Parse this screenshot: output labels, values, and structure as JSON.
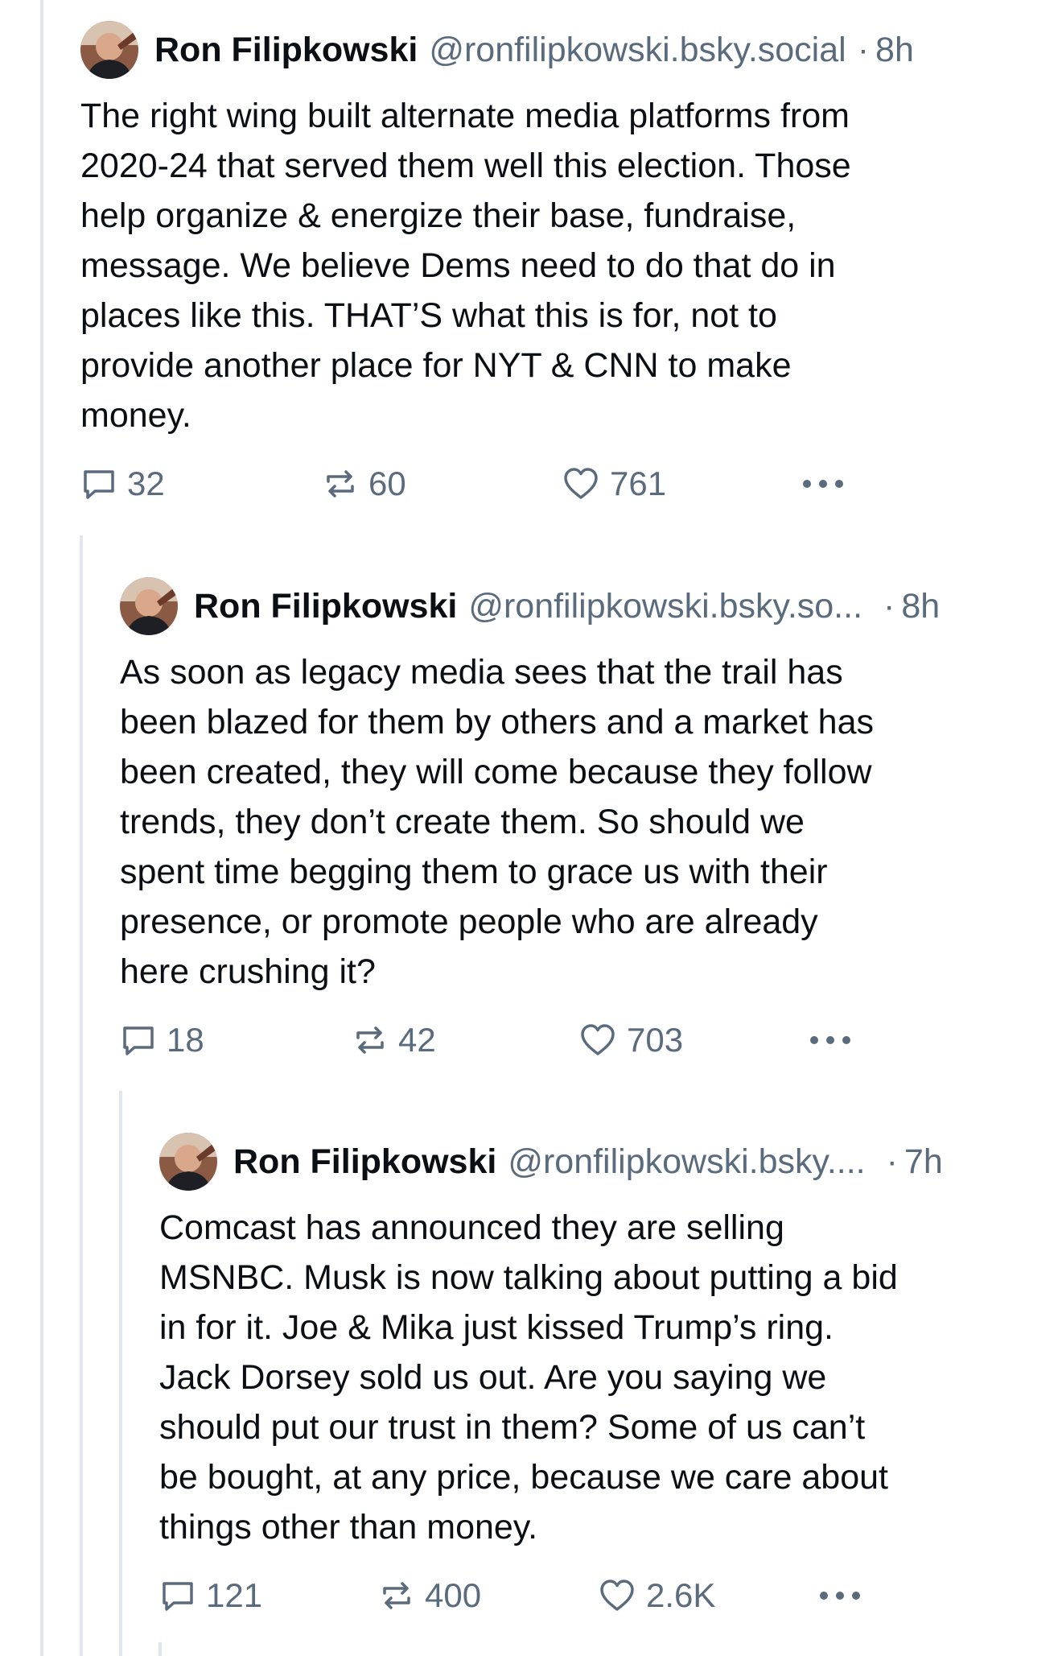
{
  "posts": [
    {
      "author": "Ron Filipkowski",
      "handle": "@ronfilipkowski.bsky.social",
      "separator": "·",
      "time": "8h",
      "text": "The right wing built alternate media platforms from\n2020-24 that served them well this election. Those\nhelp organize & energize their base, fundraise,\nmessage. We believe Dems need to do that do in\nplaces like this. THAT’S what this is for, not to\nprovide another place for NYT & CNN to make\nmoney.",
      "replies": "32",
      "reposts": "60",
      "likes": "761"
    },
    {
      "author": "Ron Filipkowski",
      "handle": "@ronfilipkowski.bsky.so...",
      "separator": "·",
      "time": "8h",
      "text": "As soon as legacy media sees that the trail has\nbeen blazed for them by others and a market has\nbeen created, they will come because they follow\ntrends, they don’t create them. So should we\nspent time begging them to grace us with their\npresence, or promote people who are already\nhere crushing it?",
      "replies": "18",
      "reposts": "42",
      "likes": "703"
    },
    {
      "author": "Ron Filipkowski",
      "handle": "@ronfilipkowski.bsky....",
      "separator": "·",
      "time": "7h",
      "text": "Comcast has announced they are selling\nMSNBC. Musk is now talking about putting a bid\nin for it. Joe & Mika just kissed Trump’s ring.\nJack Dorsey sold us out. Are you saying we\nshould put our trust in them? Some of us can’t\nbe bought, at any price, because we care about\nthings other than money.",
      "replies": "121",
      "reposts": "400",
      "likes": "2.6K"
    }
  ],
  "icons": {
    "reply": "speech-bubble-icon",
    "repost": "repost-arrows-icon",
    "like": "heart-icon",
    "more": "ellipsis-icon",
    "avatar": "profile-photo"
  },
  "colors": {
    "text": "#0b0f14",
    "muted": "#5b6b7e",
    "thread_line": "#e2e7ee"
  }
}
